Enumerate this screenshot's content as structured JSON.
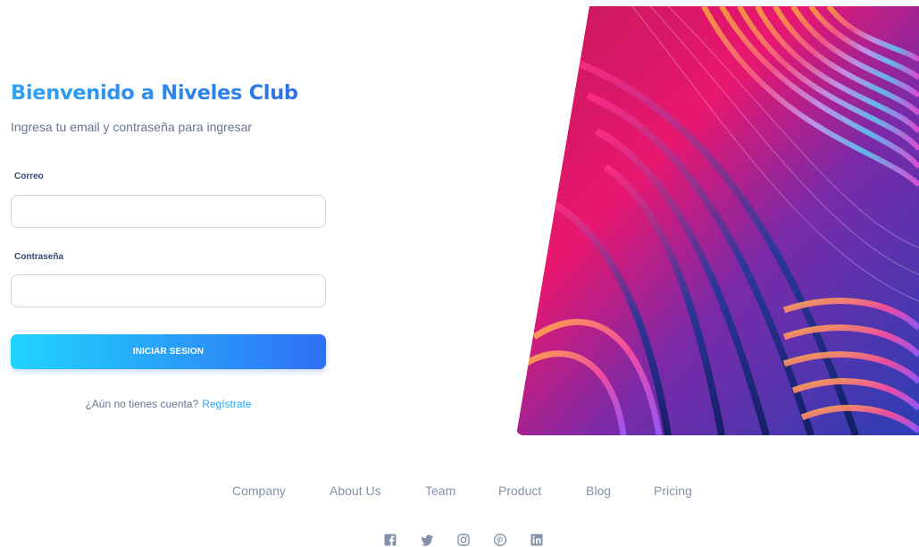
{
  "login": {
    "title": "Bienvenido a Niveles Club",
    "subtitle": "Ingresa tu email y contraseña para ingresar",
    "email_label": "Correo",
    "email_value": "",
    "password_label": "Contraseña",
    "password_value": "",
    "submit_label": "INICIAR SESION",
    "signup_prompt": "¿Aún no tienes cuenta?",
    "signup_link": "Regístrate"
  },
  "footer": {
    "links": [
      "Company",
      "About Us",
      "Team",
      "Product",
      "Blog",
      "Pricing"
    ],
    "social_icons": [
      "facebook-icon",
      "twitter-icon",
      "instagram-icon",
      "pinterest-icon",
      "linkedin-icon"
    ]
  },
  "colors": {
    "title_gradient_start": "#2fa4f7",
    "title_gradient_end": "#2c6ce8",
    "button_gradient_start": "#21d4fd",
    "button_gradient_end": "#2f6ff5",
    "link": "#2fa4f7",
    "muted_text": "#67748e",
    "footer_text": "#8392ab"
  }
}
